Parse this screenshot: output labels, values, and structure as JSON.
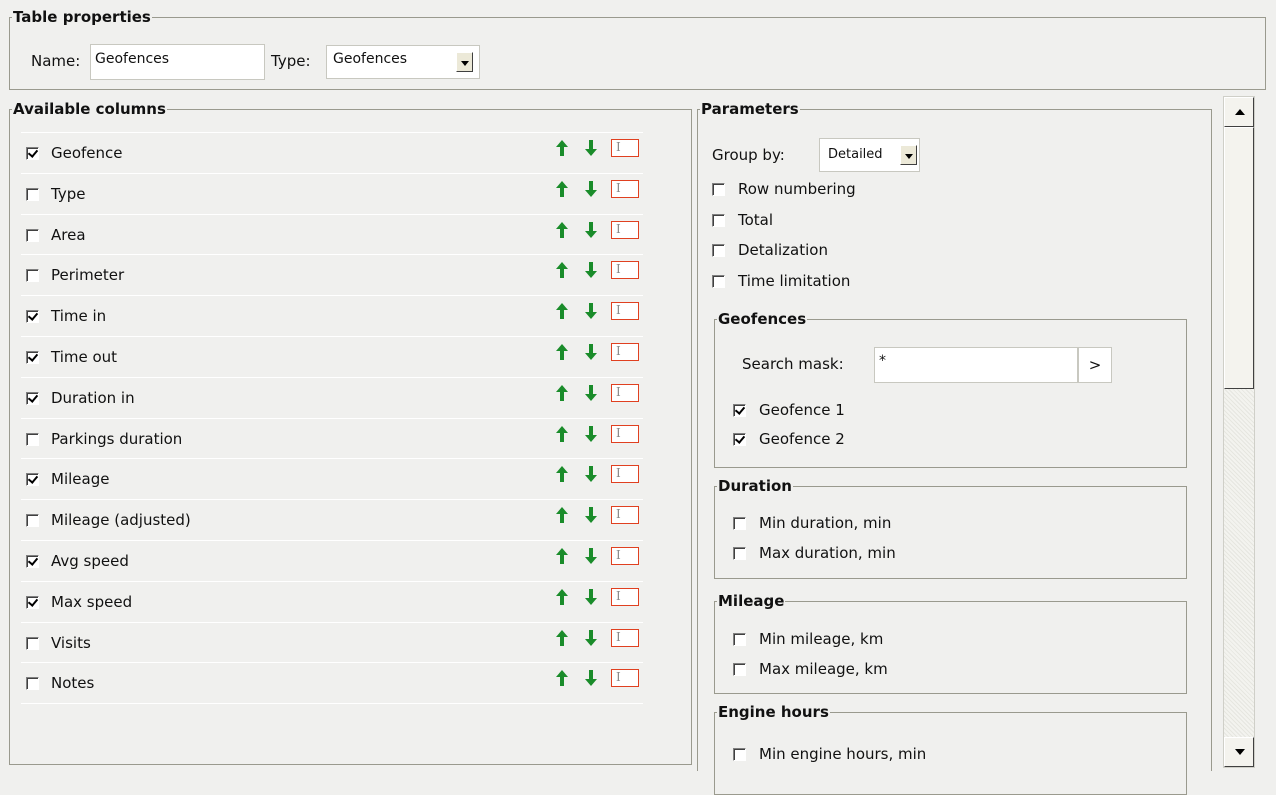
{
  "table_properties": {
    "legend": "Table properties",
    "name_label": "Name:",
    "name_value": "Geofences",
    "type_label": "Type:",
    "type_value": "Geofences"
  },
  "available_columns": {
    "legend": "Available columns",
    "rows": [
      {
        "label": "Geofence",
        "checked": true
      },
      {
        "label": "Type",
        "checked": false
      },
      {
        "label": "Area",
        "checked": false
      },
      {
        "label": "Perimeter",
        "checked": false
      },
      {
        "label": "Time in",
        "checked": true
      },
      {
        "label": "Time out",
        "checked": true
      },
      {
        "label": "Duration in",
        "checked": true
      },
      {
        "label": "Parkings duration",
        "checked": false
      },
      {
        "label": "Mileage",
        "checked": true
      },
      {
        "label": "Mileage (adjusted)",
        "checked": false
      },
      {
        "label": "Avg speed",
        "checked": true
      },
      {
        "label": "Max speed",
        "checked": true
      },
      {
        "label": "Visits",
        "checked": false
      },
      {
        "label": "Notes",
        "checked": false
      }
    ]
  },
  "parameters": {
    "legend": "Parameters",
    "group_by_label": "Group by:",
    "group_by_value": "Detailed",
    "options": [
      {
        "label": "Row numbering",
        "checked": false
      },
      {
        "label": "Total",
        "checked": false
      },
      {
        "label": "Detalization",
        "checked": false
      },
      {
        "label": "Time limitation",
        "checked": false
      }
    ],
    "geofences": {
      "legend": "Geofences",
      "search_label": "Search mask:",
      "search_value": "*",
      "go_label": ">",
      "items": [
        {
          "label": "Geofence 1",
          "checked": true
        },
        {
          "label": "Geofence 2",
          "checked": true
        }
      ]
    },
    "duration": {
      "legend": "Duration",
      "items": [
        {
          "label": "Min duration, min",
          "checked": false
        },
        {
          "label": "Max duration, min",
          "checked": false
        }
      ]
    },
    "mileage": {
      "legend": "Mileage",
      "items": [
        {
          "label": "Min mileage, km",
          "checked": false
        },
        {
          "label": "Max mileage, km",
          "checked": false
        }
      ]
    },
    "engine_hours": {
      "legend": "Engine hours",
      "items": [
        {
          "label": "Min engine hours, min",
          "checked": false
        }
      ]
    }
  },
  "colors": {
    "arrow_green": "#1a8c2a",
    "rename_border": "#e04020"
  }
}
